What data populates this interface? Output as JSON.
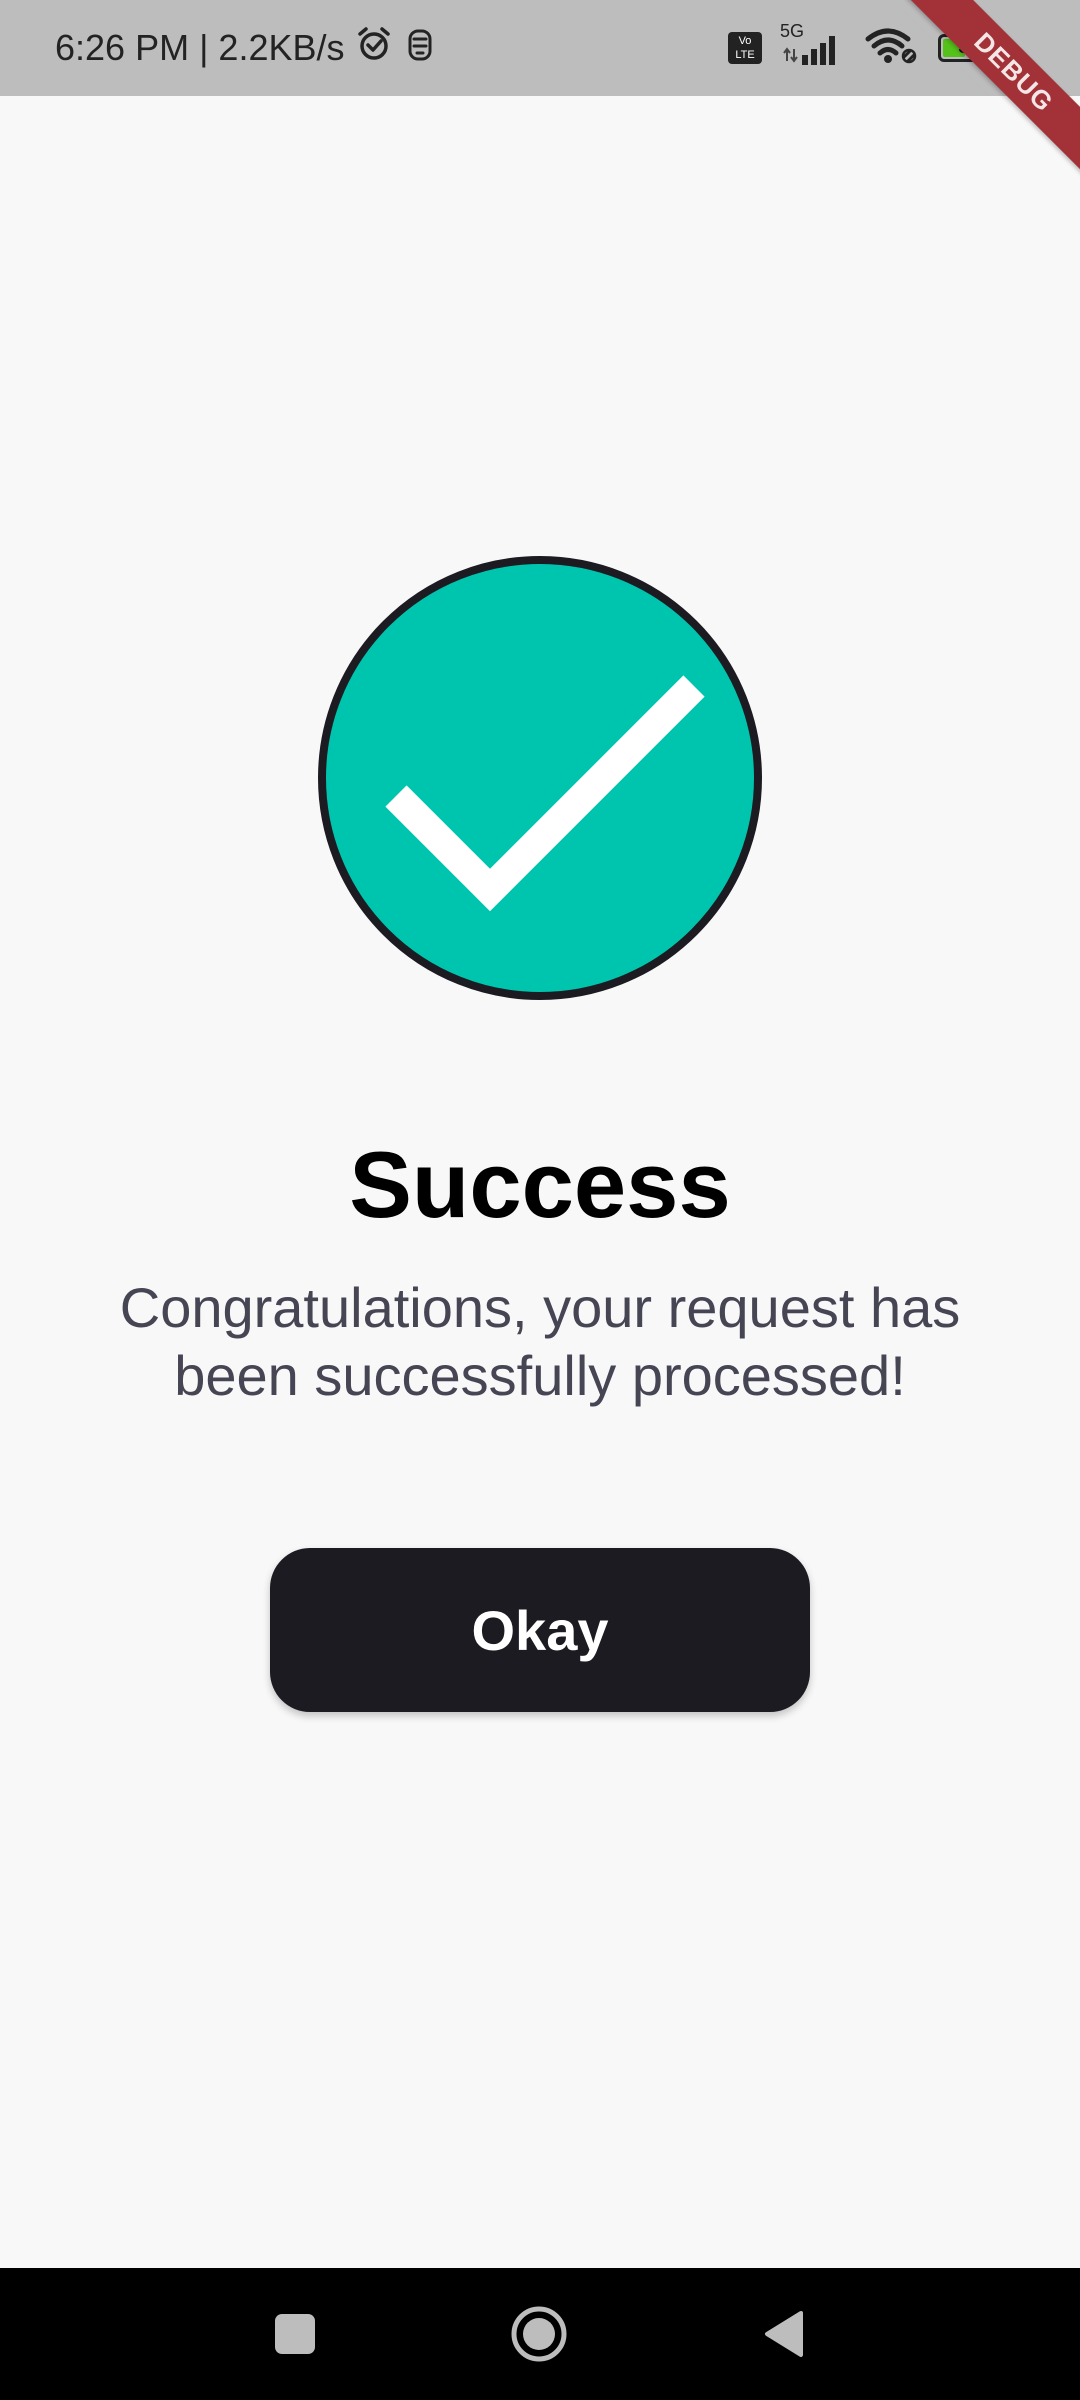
{
  "status_bar": {
    "time_speed": "6:26 PM | 2.2KB/s",
    "volte_label": "Vo LTE",
    "network_label": "5G",
    "battery_level": "39",
    "battery_fraction": 0.39,
    "icons": [
      "alarm-icon",
      "notification-icon",
      "volte-icon",
      "signal-icon",
      "wifi-icon",
      "battery-icon"
    ]
  },
  "debug_ribbon": {
    "label": "DEBUG"
  },
  "success": {
    "icon": "checkmark-circle-icon",
    "icon_color": "#00c5ae",
    "title": "Success",
    "message": "Congratulations, your request has been successfully processed!"
  },
  "button": {
    "label": "Okay",
    "color": "#1b1b21"
  },
  "nav_bar": {
    "icons": [
      "recent-apps-icon",
      "home-icon",
      "back-icon"
    ]
  }
}
